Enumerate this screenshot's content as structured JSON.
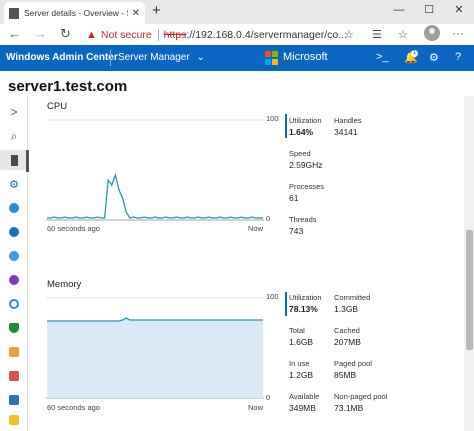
{
  "browser": {
    "tab_title": "Server details - Overview - Serv",
    "tab_close": "✕",
    "new_tab": "+",
    "not_secure": "Not secure",
    "url_protocol": "https",
    "url_rest": "://192.168.0.4/servermanager/co...",
    "minimize": "—",
    "maximize": "☐",
    "close": "✕",
    "back": "←",
    "forward": "→",
    "reload": "↻",
    "star": "☆",
    "collections": "☰",
    "more": "···"
  },
  "header": {
    "app_title": "Windows Admin Center",
    "tool_menu": "Server Manager",
    "tool_chevron": "⌄",
    "brand": "Microsoft",
    "terminal_icon": ">_",
    "notification_count": "1",
    "notification_icon": "🔔",
    "settings_icon": "⚙",
    "help_icon": "?"
  },
  "server": {
    "name": "server1.test.com"
  },
  "rail": {
    "expand": ">",
    "search": "⌕"
  },
  "cpu": {
    "title": "CPU",
    "y_max": "100",
    "y_min": "0",
    "x_left": "60 seconds ago",
    "x_right": "Now",
    "utilization_label": "Utilization",
    "utilization_value": "1.64%",
    "handles_label": "Handles",
    "handles_value": "34141",
    "speed_label": "Speed",
    "speed_value": "2.59GHz",
    "processes_label": "Processes",
    "processes_value": "61",
    "threads_label": "Threads",
    "threads_value": "743"
  },
  "memory": {
    "title": "Memory",
    "y_max": "100",
    "y_min": "0",
    "x_left": "60 seconds ago",
    "x_right": "Now",
    "utilization_label": "Utilization",
    "utilization_value": "78.13%",
    "committed_label": "Committed",
    "committed_value": "1.3GB",
    "total_label": "Total",
    "total_value": "1.6GB",
    "cached_label": "Cached",
    "cached_value": "207MB",
    "in_use_label": "In use",
    "in_use_value": "1.2GB",
    "paged_pool_label": "Paged pool",
    "paged_pool_value": "85MB",
    "available_label": "Available",
    "available_value": "349MB",
    "non_paged_pool_label": "Non-paged pool",
    "non_paged_pool_value": "73.1MB"
  },
  "colors": {
    "accent": "#0b66c3",
    "chart_line": "#2f8fc0",
    "chart_fill": "#dbe9f6",
    "warning": "#c42b1c"
  },
  "chart_data": [
    {
      "type": "line",
      "title": "CPU",
      "ylim": [
        0,
        100
      ],
      "x": [
        0,
        1,
        2,
        3,
        4,
        5,
        6,
        7,
        8,
        9,
        10,
        11,
        12,
        13,
        14,
        15,
        16,
        17,
        18,
        19,
        20,
        21,
        22,
        23,
        24,
        25,
        26,
        27,
        28,
        29,
        30,
        31,
        32,
        33,
        34,
        35,
        36,
        37,
        38,
        39,
        40,
        41,
        42,
        43,
        44,
        45,
        46,
        47,
        48,
        49,
        50,
        51,
        52,
        53,
        54,
        55,
        56,
        57,
        58,
        59,
        60
      ],
      "series": [
        {
          "values": [
            2,
            2,
            3,
            2,
            2,
            3,
            2,
            2,
            3,
            2,
            2,
            3,
            2,
            2,
            3,
            2,
            2,
            40,
            35,
            45,
            30,
            22,
            8,
            2,
            3,
            2,
            2,
            3,
            2,
            2,
            3,
            2,
            2,
            3,
            2,
            2,
            3,
            2,
            2,
            3,
            2,
            2,
            3,
            2,
            2,
            3,
            2,
            2,
            3,
            2,
            2,
            3,
            2,
            2,
            3,
            2,
            2,
            3,
            2,
            2,
            2
          ]
        }
      ],
      "xlabel": "",
      "ylabel": ""
    },
    {
      "type": "area",
      "title": "Memory",
      "ylim": [
        0,
        100
      ],
      "x": [
        0,
        1,
        2,
        3,
        4,
        5,
        6,
        7,
        8,
        9,
        10,
        11,
        12,
        13,
        14,
        15,
        16,
        17,
        18,
        19,
        20,
        21,
        22,
        23,
        24,
        25,
        26,
        27,
        28,
        29,
        30,
        31,
        32,
        33,
        34,
        35,
        36,
        37,
        38,
        39,
        40,
        41,
        42,
        43,
        44,
        45,
        46,
        47,
        48,
        49,
        50,
        51,
        52,
        53,
        54,
        55,
        56,
        57,
        58,
        59,
        60
      ],
      "series": [
        {
          "values": [
            77,
            77,
            77,
            77,
            77,
            77,
            77,
            77,
            77,
            77,
            77,
            77,
            77,
            77,
            77,
            77,
            77,
            77,
            77,
            77,
            77,
            78,
            80,
            78,
            78,
            78,
            78,
            78,
            78,
            78,
            78,
            78,
            78,
            78,
            78,
            78,
            78,
            78,
            78,
            78,
            78,
            78,
            78,
            78,
            78,
            78,
            78,
            78,
            78,
            78,
            78,
            78,
            78,
            78,
            78,
            78,
            78,
            78,
            78,
            78,
            78
          ]
        }
      ],
      "xlabel": "",
      "ylabel": ""
    }
  ]
}
